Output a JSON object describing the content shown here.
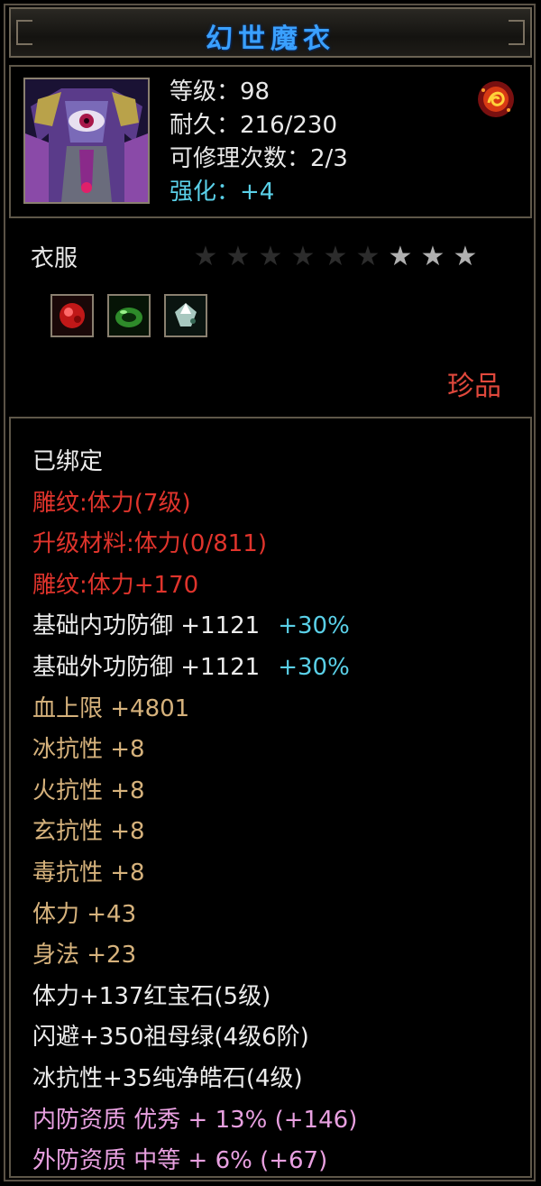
{
  "title": "幻世魔衣",
  "stats": {
    "level": "等级：98",
    "durability": "耐久：216/230",
    "repair": "可修理次数：2/3",
    "enhance": "强化：+4"
  },
  "category": "衣服",
  "stars": {
    "total": 9,
    "lit": 3
  },
  "quality": "珍品",
  "attributes": [
    {
      "text": "已绑定",
      "color": "white"
    },
    {
      "text": "雕纹:体力(7级)",
      "color": "red"
    },
    {
      "text": "升级材料:体力(0/811)",
      "color": "red"
    },
    {
      "text": "雕纹:体力+170",
      "color": "red"
    },
    {
      "text": "基础内功防御  +1121",
      "color": "white",
      "extra": "+30%"
    },
    {
      "text": "基础外功防御  +1121",
      "color": "white",
      "extra": "+30%"
    },
    {
      "text": "血上限  +4801",
      "color": "gold"
    },
    {
      "text": "冰抗性  +8",
      "color": "gold"
    },
    {
      "text": "火抗性  +8",
      "color": "gold"
    },
    {
      "text": "玄抗性  +8",
      "color": "gold"
    },
    {
      "text": "毒抗性  +8",
      "color": "gold"
    },
    {
      "text": "体力  +43",
      "color": "gold"
    },
    {
      "text": "身法  +23",
      "color": "gold"
    },
    {
      "text": "体力+137红宝石(5级)",
      "color": "white"
    },
    {
      "text": "闪避+350祖母绿(4级6阶)",
      "color": "white"
    },
    {
      "text": "冰抗性+35纯净皓石(4级)",
      "color": "white"
    },
    {
      "text": "内防资质  优秀  + 13% (+146)",
      "color": "pink"
    },
    {
      "text": "外防资质  中等  + 6% (+67)",
      "color": "pink"
    }
  ]
}
